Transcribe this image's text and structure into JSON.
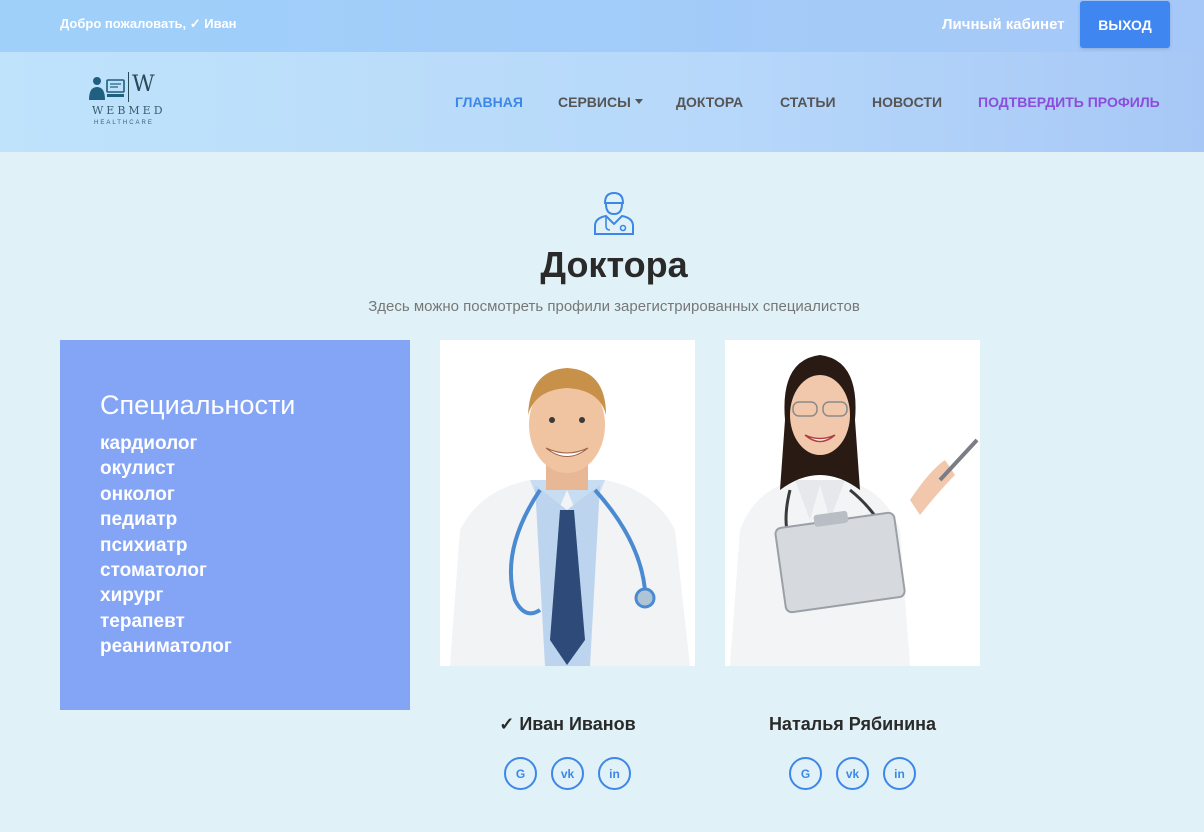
{
  "topbar": {
    "welcome": "Добро пожаловать, ✓ Иван",
    "cabinet": "Личный кабинет",
    "logout": "ВЫХОД"
  },
  "logo": {
    "letter": "W",
    "name": "WEBMED",
    "tagline": "HEALTHCARE"
  },
  "nav": {
    "home": "ГЛАВНАЯ",
    "services": "СЕРВИСЫ",
    "doctors": "ДОКТОРА",
    "articles": "СТАТЬИ",
    "news": "НОВОСТИ",
    "verify": "ПОДТВЕРДИТЬ ПРОФИЛЬ"
  },
  "main": {
    "title": "Доктора",
    "subtitle": "Здесь можно посмотреть профили зарегистрированных специалистов"
  },
  "specialties": {
    "title": "Специальности",
    "items": [
      "кардиолог",
      "окулист",
      "онколог",
      "педиатр",
      "психиатр",
      "стоматолог",
      "хирург",
      "терапевт",
      "реаниматолог"
    ]
  },
  "doctors": [
    {
      "name": "✓ Иван Иванов",
      "socials": [
        "G",
        "vk",
        "in"
      ]
    },
    {
      "name": "Наталья Рябинина",
      "socials": [
        "G",
        "vk",
        "in"
      ]
    }
  ],
  "colors": {
    "accent": "#3d87e8",
    "purple": "#8a4ddc",
    "spec_box": "#84a4f6",
    "background": "#e0f2f8"
  }
}
